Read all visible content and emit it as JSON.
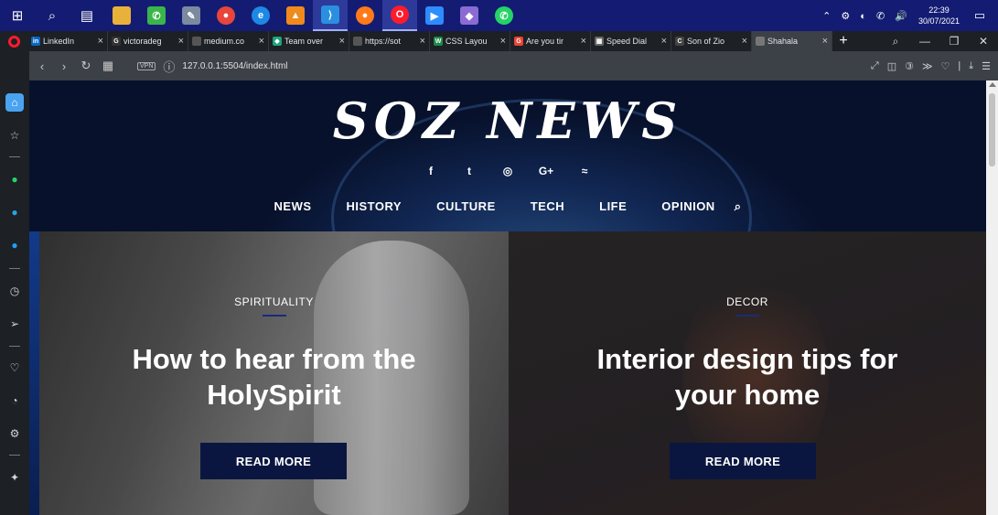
{
  "taskbar": {
    "time": "22:39",
    "date": "30/07/2021",
    "tray_icons": "⌃ ⚙ ◐ ✆ 🔊"
  },
  "browser": {
    "tabs": [
      {
        "label": "LinkedIn",
        "icon": "linkedin-icon",
        "color": "#0a66c2",
        "glyph": "in"
      },
      {
        "label": "victoradeg",
        "icon": "github-icon",
        "color": "#333333",
        "glyph": "G"
      },
      {
        "label": "medium.co",
        "icon": "page-icon",
        "color": "#555555",
        "glyph": ""
      },
      {
        "label": "Team over",
        "icon": "diamond-icon",
        "color": "#1fa37a",
        "glyph": "◆"
      },
      {
        "label": "https://sot",
        "icon": "page-icon",
        "color": "#555555",
        "glyph": ""
      },
      {
        "label": "CSS Layou",
        "icon": "w-icon",
        "color": "#1a8a4a",
        "glyph": "W"
      },
      {
        "label": "Are you tir",
        "icon": "google-icon",
        "color": "#ea4335",
        "glyph": "G"
      },
      {
        "label": "Speed Dial",
        "icon": "grid-icon",
        "color": "#666666",
        "glyph": "▦"
      },
      {
        "label": "Son of Zio",
        "icon": "c-icon",
        "color": "#444444",
        "glyph": "C"
      },
      {
        "label": "Shahala",
        "icon": "page-icon",
        "color": "#777777",
        "glyph": ""
      }
    ],
    "url": "127.0.0.1:5504/index.html",
    "vpn_label": "VPN"
  },
  "site": {
    "logo": "SOZ NEWS",
    "socials": [
      "f",
      "t",
      "◎",
      "G+",
      "≈"
    ],
    "menu": [
      "NEWS",
      "HISTORY",
      "CULTURE",
      "TECH",
      "LIFE",
      "OPINION"
    ],
    "search_glyph": "⌕",
    "cards": [
      {
        "category": "SPIRITUALITY",
        "headline_line1": "How to hear from the",
        "headline_line2": "HolySpirit",
        "button": "READ MORE"
      },
      {
        "category": "DECOR",
        "headline_line1": "Interior design tips for",
        "headline_line2": "your home",
        "button": "READ MORE"
      }
    ]
  }
}
